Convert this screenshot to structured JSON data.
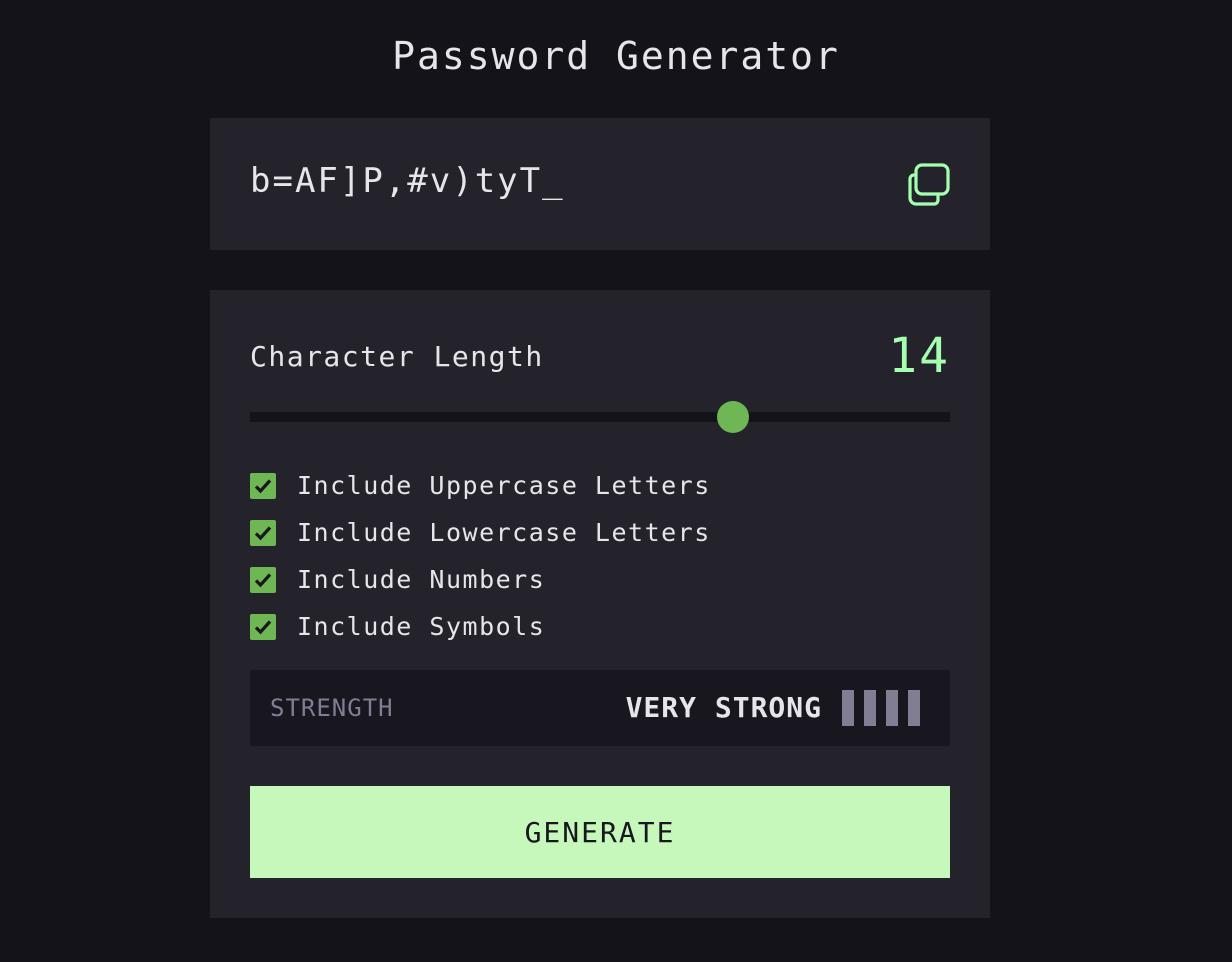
{
  "app": {
    "title": "Password Generator"
  },
  "output": {
    "password": "b=AF]P,#v)tyT_",
    "copy_icon": "copy-icon"
  },
  "length": {
    "label": "Character Length",
    "value": "14",
    "slider_fraction": 0.69
  },
  "options": [
    {
      "label": "Include Uppercase Letters",
      "checked": true
    },
    {
      "label": "Include Lowercase Letters",
      "checked": true
    },
    {
      "label": "Include Numbers",
      "checked": true
    },
    {
      "label": "Include Symbols",
      "checked": true
    }
  ],
  "strength": {
    "label": "STRENGTH",
    "value": "VERY STRONG",
    "bars_filled": 4,
    "bars_total": 4
  },
  "generate": {
    "label": "GENERATE"
  },
  "colors": {
    "background": "#141319",
    "card": "#24232c",
    "accent_green": "#a4ffaf",
    "check_green": "#6fb654",
    "button_green": "#c6f7bb",
    "muted_grey": "#817d92"
  }
}
